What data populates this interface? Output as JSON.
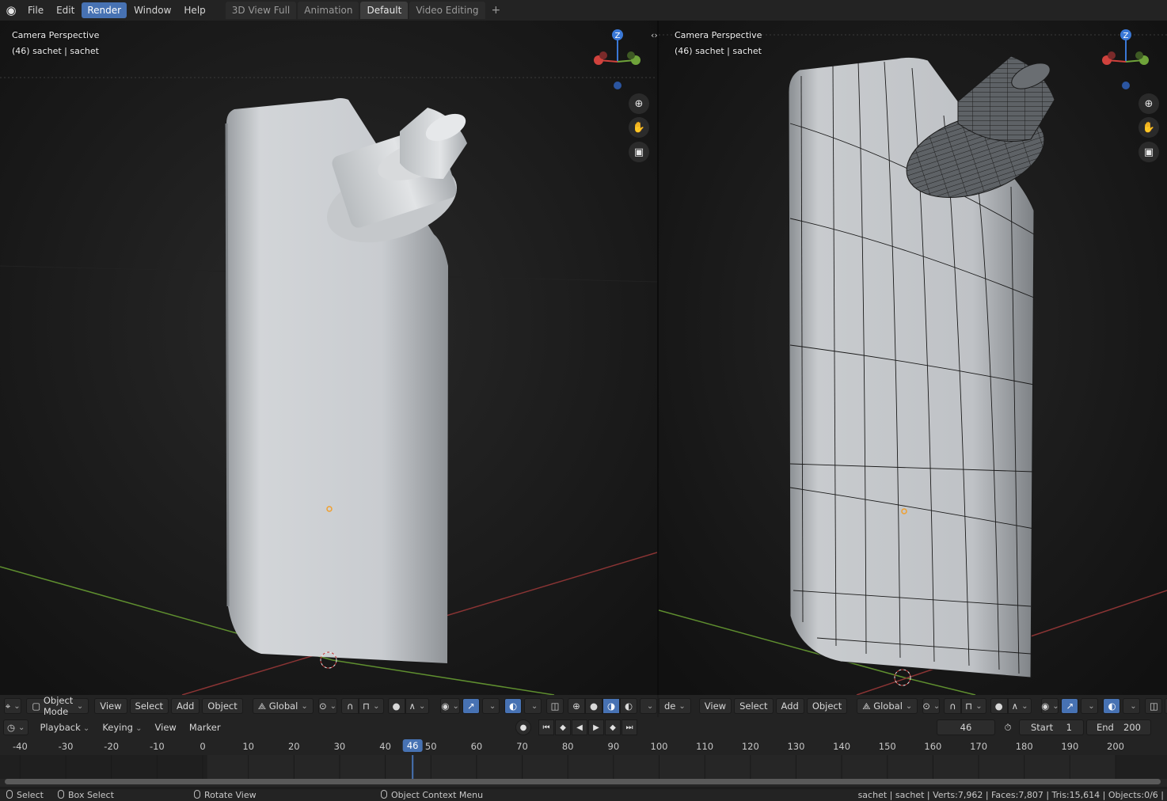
{
  "menus": [
    "File",
    "Edit",
    "Render",
    "Window",
    "Help"
  ],
  "active_menu": "Render",
  "workspaces": [
    "3D View Full",
    "Animation",
    "Default",
    "Video Editing"
  ],
  "active_workspace": "Default",
  "viewport_left": {
    "line1": "Camera Perspective",
    "line2": "(46) sachet | sachet"
  },
  "viewport_right": {
    "line1": "Camera Perspective",
    "line2": "(46) sachet | sachet"
  },
  "gizmo_axis": "Z",
  "header_left": {
    "mode": "Object Mode",
    "view": "View",
    "select": "Select",
    "add": "Add",
    "object": "Object",
    "orientation": "Global"
  },
  "header_right": {
    "mode_partial": "de",
    "view": "View",
    "select": "Select",
    "add": "Add",
    "object": "Object",
    "orientation": "Global"
  },
  "timeline": {
    "playback": "Playback",
    "keying": "Keying",
    "view": "View",
    "marker": "Marker",
    "current_frame": "46",
    "start_label": "Start",
    "start_value": "1",
    "end_label": "End",
    "end_value": "200",
    "ticks": [
      "-40",
      "-30",
      "-20",
      "-10",
      "0",
      "10",
      "20",
      "30",
      "40",
      "50",
      "60",
      "70",
      "80",
      "90",
      "100",
      "110",
      "120",
      "130",
      "140",
      "150",
      "160",
      "170",
      "180",
      "190",
      "200"
    ]
  },
  "status": {
    "select": "Select",
    "box_select": "Box Select",
    "rotate_view": "Rotate View",
    "context_menu": "Object Context Menu",
    "stats": "sachet | sachet | Verts:7,962 | Faces:7,807 | Tris:15,614 | Objects:0/6 |"
  },
  "colors": {
    "accent": "#4772b3",
    "x_axis": "#d0423d",
    "y_axis": "#6fa33a",
    "z_axis": "#3a78d6"
  }
}
